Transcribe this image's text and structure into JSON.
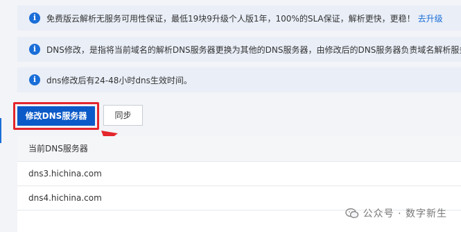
{
  "notices": [
    {
      "icon": "info-icon",
      "text": "免费版云解析无服务可用性保证，最低19块9升级个人版1年，100%的SLA保证，解析更快，更稳！",
      "link": "去升级"
    },
    {
      "icon": "info-icon",
      "text": "DNS修改，是指将当前域名的解析DNS服务器更换为其他的DNS服务器，由修改后的DNS服务器负责域名解析服务"
    },
    {
      "icon": "info-icon",
      "text": "dns修改后有24-48小时dns生效时间。"
    }
  ],
  "info_glyph": "i",
  "buttons": {
    "modify_dns": "修改DNS服务器",
    "sync": "同步"
  },
  "table": {
    "header": "当前DNS服务器",
    "rows": [
      "dns3.hichina.com",
      "dns4.hichina.com"
    ]
  },
  "watermark": {
    "text": "公众号 · 数字新生"
  },
  "colors": {
    "accent": "#0b5ac8",
    "highlight": "#e3262c",
    "notice_bg": "#e9eef7"
  }
}
